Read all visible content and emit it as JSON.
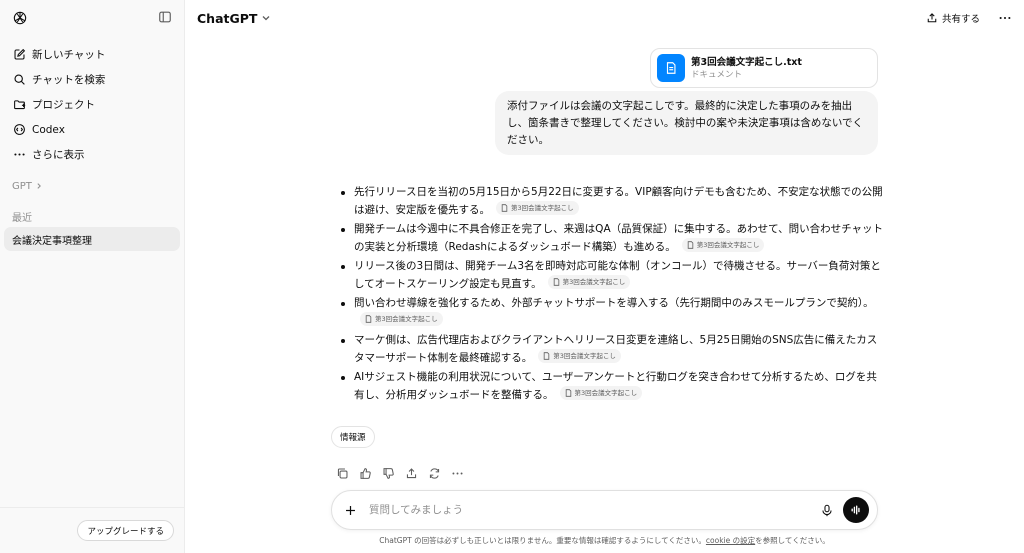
{
  "sidebar": {
    "items": [
      {
        "label": "新しいチャット",
        "icon": "compose-icon"
      },
      {
        "label": "チャットを検索",
        "icon": "search-icon"
      },
      {
        "label": "プロジェクト",
        "icon": "folder-icon"
      },
      {
        "label": "Codex",
        "icon": "codex-icon"
      },
      {
        "label": "さらに表示",
        "icon": "more-icon"
      }
    ],
    "gpt_label": "GPT",
    "recent_label": "最近",
    "chats": [
      "会議決定事項整理"
    ],
    "upgrade_label": "アップグレードする"
  },
  "header": {
    "model": "ChatGPT",
    "share_label": "共有する"
  },
  "attachment": {
    "name": "第3回会議文字起こし.txt",
    "type": "ドキュメント"
  },
  "user_message": "添付ファイルは会議の文字起こしです。最終的に決定した事項のみを抽出し、箇条書きで整理してください。検討中の案や未決定事項は含めないでください。",
  "answer": {
    "bullets": [
      {
        "text": "先行リリース日を当初の5月15日から5月22日に変更する。VIP顧客向けデモも含むため、不安定な状態での公開は避け、安定版を優先する。",
        "cite": "第3回会議文字起こし"
      },
      {
        "text": "開発チームは今週中に不具合修正を完了し、来週はQA（品質保証）に集中する。あわせて、問い合わせチャットの実装と分析環境（Redashによるダッシュボード構築）も進める。",
        "cite": "第3回会議文字起こし"
      },
      {
        "text": "リリース後の3日間は、開発チーム3名を即時対応可能な体制（オンコール）で待機させる。サーバー負荷対策としてオートスケーリング設定も見直す。",
        "cite": "第3回会議文字起こし"
      },
      {
        "text": "問い合わせ導線を強化するため、外部チャットサポートを導入する（先行期間中のみスモールプランで契約）。",
        "cite": "第3回会議文字起こし"
      },
      {
        "text": "マーケ側は、広告代理店およびクライアントへリリース日変更を連絡し、5月25日開始のSNS広告に備えたカスタマーサポート体制を最終確認する。",
        "cite": "第3回会議文字起こし"
      },
      {
        "text": "AIサジェスト機能の利用状況について、ユーザーアンケートと行動ログを突き合わせて分析するため、ログを共有し、分析用ダッシュボードを整備する。",
        "cite": "第3回会議文字起こし"
      }
    ],
    "sources_label": "情報源"
  },
  "composer": {
    "placeholder": "質問してみましょう"
  },
  "disclaimer": {
    "text": "ChatGPT の回答は必ずしも正しいとは限りません。重要な情報は確認するようにしてください。",
    "link": "cookie の設定",
    "suffix": "を参照してください。"
  },
  "colors": {
    "accent": "#0285ff",
    "sidebar_bg": "#f9f9f9",
    "bubble_bg": "#f4f4f4"
  }
}
